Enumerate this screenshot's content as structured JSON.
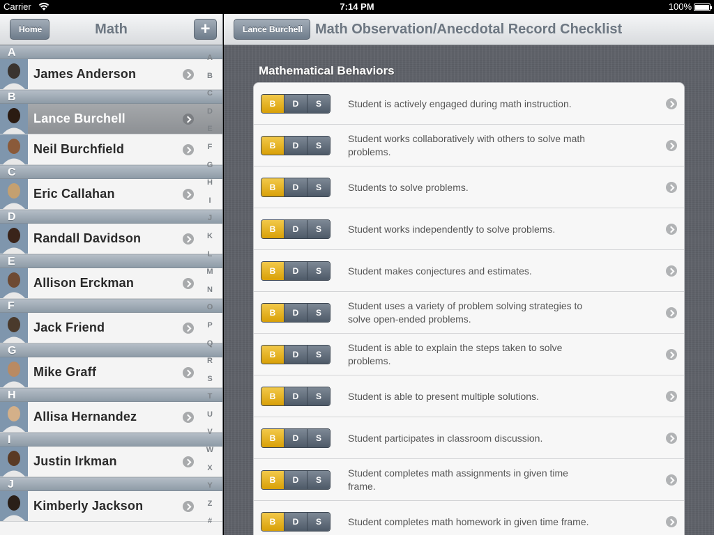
{
  "status": {
    "carrier": "Carrier",
    "time": "7:14 PM",
    "battery": "100%"
  },
  "left": {
    "back_label": "Home",
    "title": "Math",
    "add_label": "+",
    "sections": [
      {
        "letter": "A",
        "students": [
          {
            "name": "James Anderson",
            "selected": false
          }
        ]
      },
      {
        "letter": "B",
        "students": [
          {
            "name": "Lance Burchell",
            "selected": true
          },
          {
            "name": "Neil Burchfield",
            "selected": false
          }
        ]
      },
      {
        "letter": "C",
        "students": [
          {
            "name": "Eric Callahan",
            "selected": false
          }
        ]
      },
      {
        "letter": "D",
        "students": [
          {
            "name": "Randall Davidson",
            "selected": false
          }
        ]
      },
      {
        "letter": "E",
        "students": [
          {
            "name": "Allison Erckman",
            "selected": false
          }
        ]
      },
      {
        "letter": "F",
        "students": [
          {
            "name": "Jack Friend",
            "selected": false
          }
        ]
      },
      {
        "letter": "G",
        "students": [
          {
            "name": "Mike Graff",
            "selected": false
          }
        ]
      },
      {
        "letter": "H",
        "students": [
          {
            "name": "Allisa Hernandez",
            "selected": false
          }
        ]
      },
      {
        "letter": "I",
        "students": [
          {
            "name": "Justin Irkman",
            "selected": false
          }
        ]
      },
      {
        "letter": "J",
        "students": [
          {
            "name": "Kimberly Jackson",
            "selected": false
          }
        ]
      }
    ],
    "index": [
      "A",
      "B",
      "C",
      "D",
      "E",
      "F",
      "G",
      "H",
      "I",
      "J",
      "K",
      "L",
      "M",
      "N",
      "O",
      "P",
      "Q",
      "R",
      "S",
      "T",
      "U",
      "V",
      "W",
      "X",
      "Y",
      "Z",
      "#"
    ]
  },
  "right": {
    "back_label": "Lance Burchell",
    "title": "Math Observation/Anecdotal Record Checklist",
    "section_header": "Mathematical Behaviors",
    "segment_labels": [
      "B",
      "D",
      "S"
    ],
    "selected_segment": "B",
    "items": [
      "Student is actively engaged during math instruction.",
      "Student works collaboratively with others to solve math problems.",
      "Students to solve problems.",
      "Student works independently to solve problems.",
      "Student makes conjectures and estimates.",
      "Student uses a variety of problem solving strategies to solve open-ended problems.",
      "Student is able to explain the steps taken to solve problems.",
      "Student is able to present multiple solutions.",
      "Student participates in classroom discussion.",
      "Student completes math assignments in given time frame.",
      "Student completes math homework in given time frame."
    ]
  },
  "colors": {
    "accent_selected": "#e8b520",
    "segment_default": "#5e6a78"
  }
}
